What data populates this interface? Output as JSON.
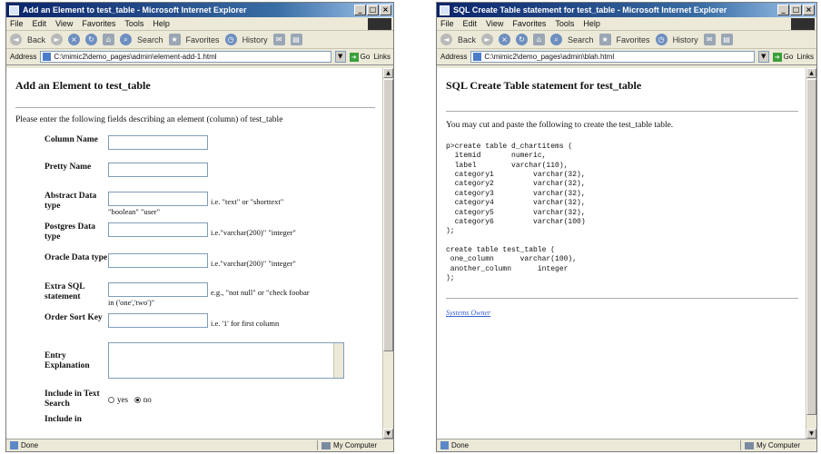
{
  "left_window": {
    "title": "Add an Element to test_table - Microsoft Internet Explorer",
    "menu": [
      "File",
      "Edit",
      "View",
      "Favorites",
      "Tools",
      "Help"
    ],
    "toolbar": {
      "back": "Back",
      "search": "Search",
      "favorites": "Favorites",
      "history": "History"
    },
    "address_label": "Address",
    "address_url": "C:\\mimic2\\demo_pages\\admin\\element-add-1.html",
    "go_label": "Go",
    "links_label": "Links",
    "status": "Done",
    "zone": "My Computer",
    "page": {
      "heading": "Add an Element to test_table",
      "intro": "Please enter the following fields describing an element (column) of test_table",
      "fields": [
        {
          "label": "Column Name",
          "help": "",
          "help2": ""
        },
        {
          "label": "Pretty Name",
          "help": "",
          "help2": ""
        },
        {
          "label": "Abstract Data type",
          "help": "i.e. \"text\" or \"shorttext\"",
          "help2": "\"boolean\" \"user\""
        },
        {
          "label": "Postgres Data type",
          "help": "i.e.\"varchar(200)\" \"integer\"",
          "help2": ""
        },
        {
          "label": "Oracle Data type",
          "help": "i.e.\"varchar(200)\" \"integer\"",
          "help2": ""
        },
        {
          "label": "Extra SQL statement",
          "help": "e.g., \"not null\" or \"check foobar",
          "help2": "in ('one','two')\""
        },
        {
          "label": "Order Sort Key",
          "help": "i.e. '1' for first column",
          "help2": ""
        }
      ],
      "entry_label": "Entry Explanation",
      "search_label": "Include in Text Search",
      "radio_yes": "yes",
      "radio_no": "no",
      "radio_selected": "no",
      "cutoff_label": "Include in"
    }
  },
  "right_window": {
    "title": "SQL Create Table statement for test_table - Microsoft Internet Explorer",
    "menu": [
      "File",
      "Edit",
      "View",
      "Favorites",
      "Tools",
      "Help"
    ],
    "toolbar": {
      "back": "Back",
      "search": "Search",
      "favorites": "Favorites",
      "history": "History"
    },
    "address_label": "Address",
    "address_url": "C:\\mimic2\\demo_pages\\admin\\blah.html",
    "go_label": "Go",
    "links_label": "Links",
    "status": "Done",
    "zone": "My Computer",
    "page": {
      "heading": "SQL Create Table statement for test_table",
      "intro": "You may cut and paste the following to create the test_table table.",
      "sql_block_1": "p>create table d_chartitems (\n  itemid       numeric,\n  label        varchar(110),\n  category1         varchar(32),\n  category2         varchar(32),\n  category3         varchar(32),\n  category4         varchar(32),\n  category5         varchar(32),\n  category6         varchar(100)\n);",
      "sql_block_2": "create table test_table (\n one_column      varchar(100),\n another_column      integer\n);",
      "footer_link": "Systems Owner"
    }
  }
}
